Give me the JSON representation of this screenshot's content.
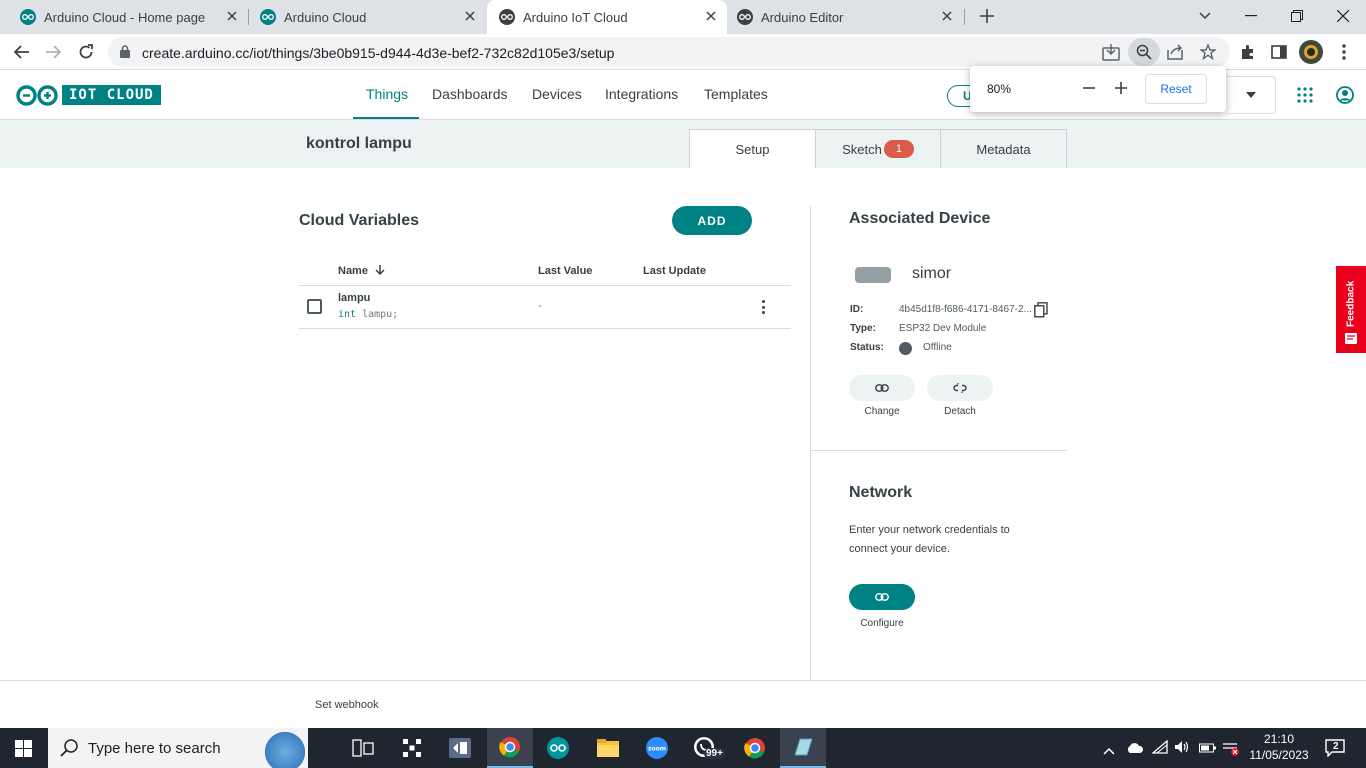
{
  "browser": {
    "tabs": [
      {
        "title": "Arduino Cloud - Home page"
      },
      {
        "title": "Arduino Cloud"
      },
      {
        "title": "Arduino IoT Cloud"
      },
      {
        "title": "Arduino Editor"
      }
    ],
    "url": "create.arduino.cc/iot/things/3be0b915-d944-4d3e-bef2-732c82d105e3/setup",
    "zoom": {
      "level": "80%",
      "reset_label": "Reset"
    }
  },
  "site": {
    "logo_text": "IOT CLOUD",
    "nav": [
      "Things",
      "Dashboards",
      "Devices",
      "Integrations",
      "Templates"
    ],
    "active_nav": "Things",
    "header_partial_button": "U"
  },
  "thing": {
    "name": "kontrol lampu",
    "tabs": {
      "setup": "Setup",
      "sketch": "Sketch",
      "sketch_badge": "1",
      "metadata": "Metadata"
    }
  },
  "cloud_variables": {
    "title": "Cloud Variables",
    "add_label": "ADD",
    "columns": {
      "name": "Name",
      "last_value": "Last Value",
      "last_update": "Last Update"
    },
    "rows": [
      {
        "name": "lampu",
        "type": "int",
        "decl_rest": " lampu;",
        "last_value": "-",
        "last_update": ""
      }
    ]
  },
  "associated_device": {
    "title": "Associated Device",
    "name": "simor",
    "labels": {
      "id": "ID:",
      "type": "Type:",
      "status": "Status:"
    },
    "id": "4b45d1f8-f686-4171-8467-2...",
    "type": "ESP32 Dev Module",
    "status": "Offline",
    "change_label": "Change",
    "detach_label": "Detach"
  },
  "network": {
    "title": "Network",
    "description": "Enter your network credentials to connect your device.",
    "configure_label": "Configure"
  },
  "footer": {
    "webhook_label": "Set webhook"
  },
  "feedback_label": "Feedback",
  "taskbar": {
    "search_placeholder": "Type here to search",
    "time": "21:10",
    "date": "11/05/2023",
    "notification_count": "2",
    "whatsapp_badge": "99+"
  },
  "colors": {
    "accent": "#008184",
    "badge": "#da5b4a",
    "feedback": "#e8001c"
  }
}
